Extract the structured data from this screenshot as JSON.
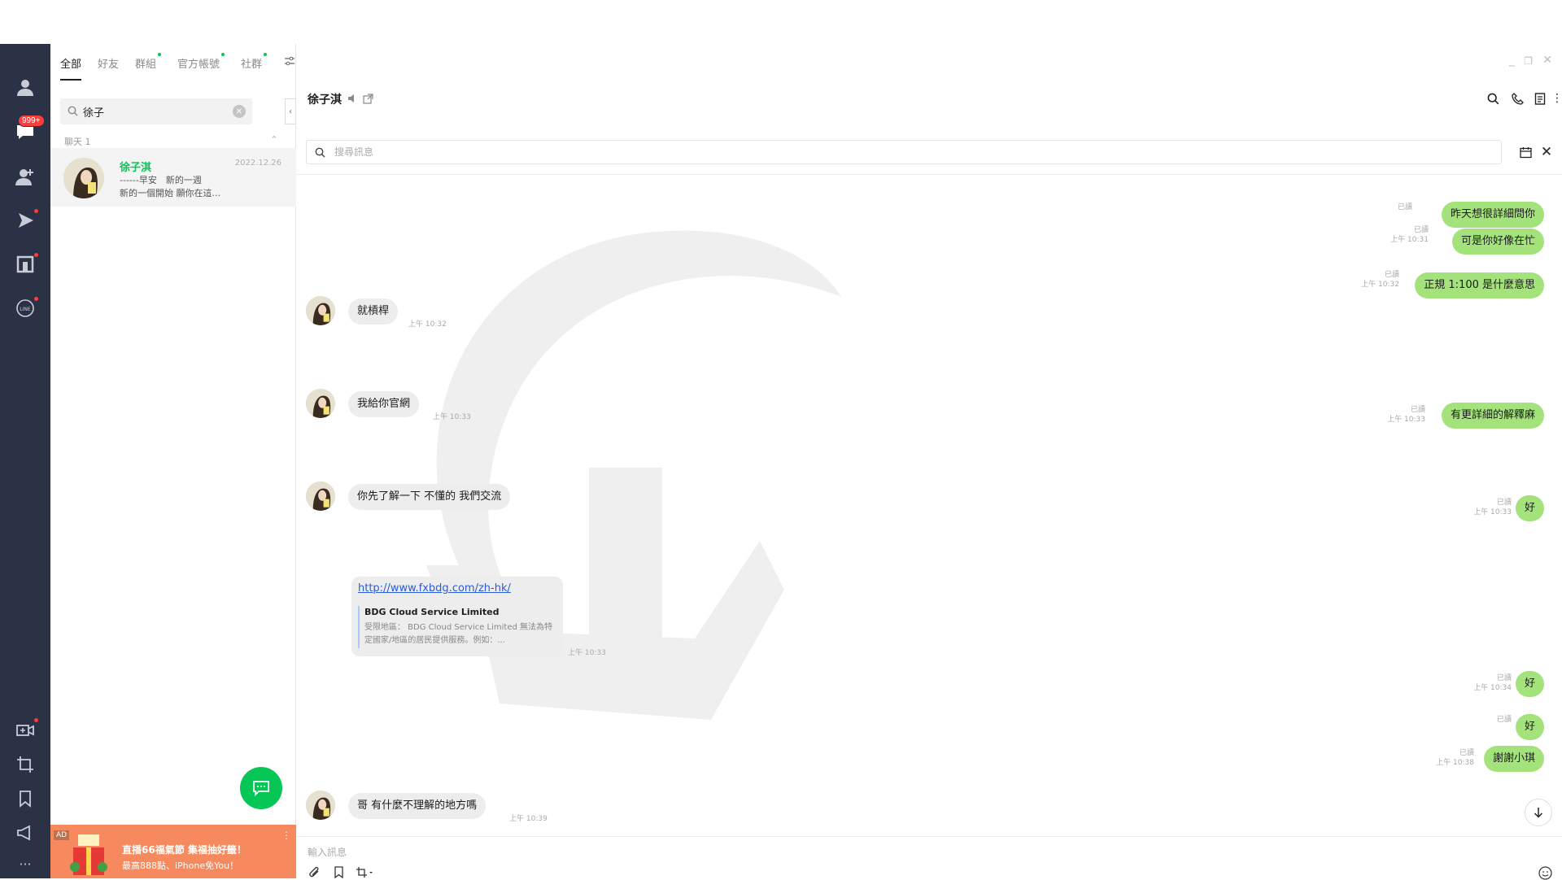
{
  "tabs": [
    {
      "label": "全部",
      "active": true,
      "dot": false
    },
    {
      "label": "好友",
      "active": false,
      "dot": false
    },
    {
      "label": "群組",
      "active": false,
      "dot": true
    },
    {
      "label": "官方帳號",
      "active": false,
      "dot": true
    },
    {
      "label": "社群",
      "active": false,
      "dot": true
    }
  ],
  "rail": {
    "badge": "999+"
  },
  "search": {
    "value": "徐子"
  },
  "section_label": "聊天 1",
  "chat_item": {
    "name": "徐子淇",
    "date": "2022.12.26",
    "preview_line1": "------早安　新的一週",
    "preview_line2": "新的一個開始 願你在這..."
  },
  "ad": {
    "tag": "AD",
    "title": "直播66福氣節 集福抽好籤！",
    "subtitle": "最高888點、iPhone免You！"
  },
  "chat_header": {
    "name": "徐子淇"
  },
  "msg_search": {
    "placeholder": "搜尋訊息"
  },
  "messages": [
    {
      "dir": "out",
      "text": "昨天想很詳細問你",
      "read": "已讀",
      "time": ""
    },
    {
      "dir": "out",
      "text": "可是你好像在忙",
      "read": "已讀",
      "time": "上午 10:31"
    },
    {
      "dir": "out",
      "text": "正規 1:100 是什麼意思",
      "read": "已讀",
      "time": "上午 10:32"
    },
    {
      "dir": "in",
      "text": "就槓桿",
      "time": "上午 10:32"
    },
    {
      "dir": "out",
      "text": "有更詳細的解釋麻",
      "read": "已讀",
      "time": "上午 10:33"
    },
    {
      "dir": "in",
      "text": "我給你官網",
      "time": "上午 10:33"
    },
    {
      "dir": "out",
      "text": "好",
      "read": "已讀",
      "time": "上午 10:33"
    },
    {
      "dir": "in",
      "text": "你先了解一下 不懂的 我們交流",
      "time": ""
    },
    {
      "dir": "out",
      "text": "好",
      "read": "已讀",
      "time": "上午 10:34"
    },
    {
      "dir": "out",
      "text": "好",
      "read": "已讀",
      "time": ""
    },
    {
      "dir": "out",
      "text": "謝謝小琪",
      "read": "已讀",
      "time": "上午 10:38"
    },
    {
      "dir": "in",
      "text": "哥 有什麼不理解的地方嗎",
      "time": "上午 10:39"
    }
  ],
  "link_card": {
    "url": "http://www.fxbdg.com/zh-hk/",
    "title": "BDG Cloud Service Limited",
    "desc": "受限地區： BDG Cloud Service Limited 無法為特定國家/地區的居民提供服務。例如：...",
    "time": "上午 10:33"
  },
  "composer": {
    "placeholder": "輸入訊息"
  },
  "colors": {
    "rail": "#2b3246",
    "accent": "#06c755",
    "bubble_out": "#a4e37c",
    "bubble_in": "#ededed",
    "ad": "#f6895e"
  }
}
